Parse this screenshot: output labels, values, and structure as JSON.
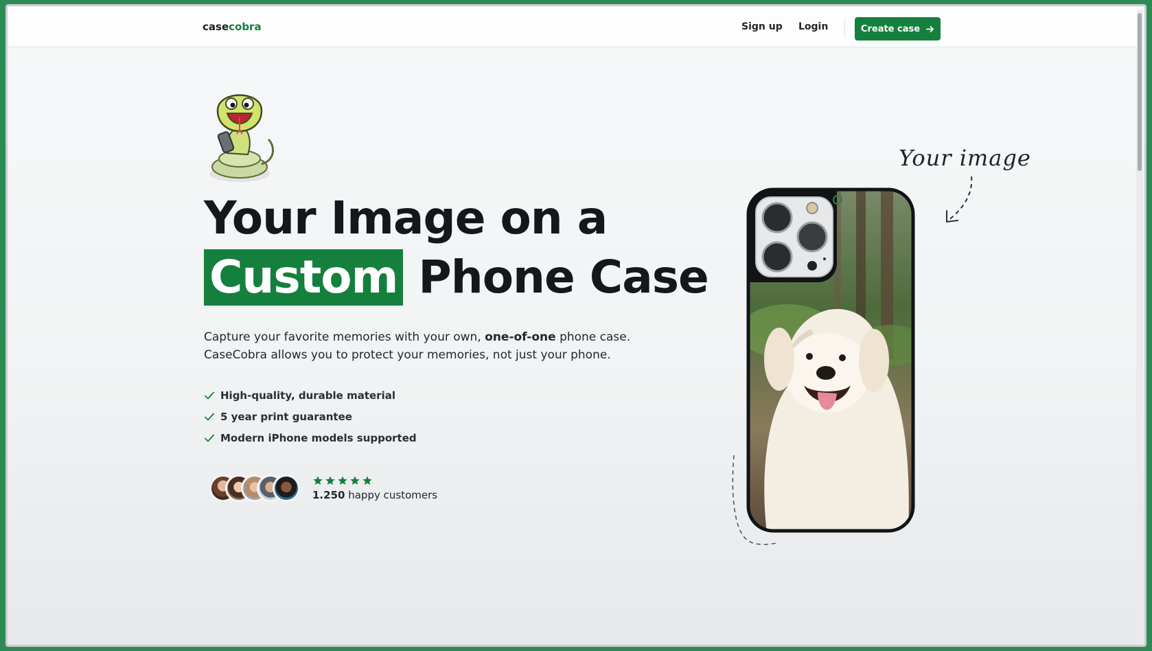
{
  "navbar": {
    "logo_part1": "case",
    "logo_part2": "cobra",
    "signup_label": "Sign up",
    "login_label": "Login",
    "create_label": "Create case",
    "arrow_icon": "arrow-right-icon"
  },
  "hero": {
    "headline_line1": "Your Image on a",
    "headline_highlight": "Custom",
    "headline_rest": "Phone Case",
    "desc_part1": "Capture your favorite memories with your own,",
    "desc_bold": "one-of-one",
    "desc_part2": "phone case.",
    "desc_line2": "CaseCobra allows you to protect your memories, not just your phone.",
    "features": [
      "High-quality, durable material",
      "5 year print guarantee",
      "Modern iPhone models supported"
    ],
    "rating_stars": 5,
    "customers_count": "1.250",
    "customers_label": "happy customers"
  },
  "showcase": {
    "annotation": "Your image"
  },
  "colors": {
    "accent": "#15803d",
    "text": "#14171b",
    "window_border": "#2e8a55"
  }
}
